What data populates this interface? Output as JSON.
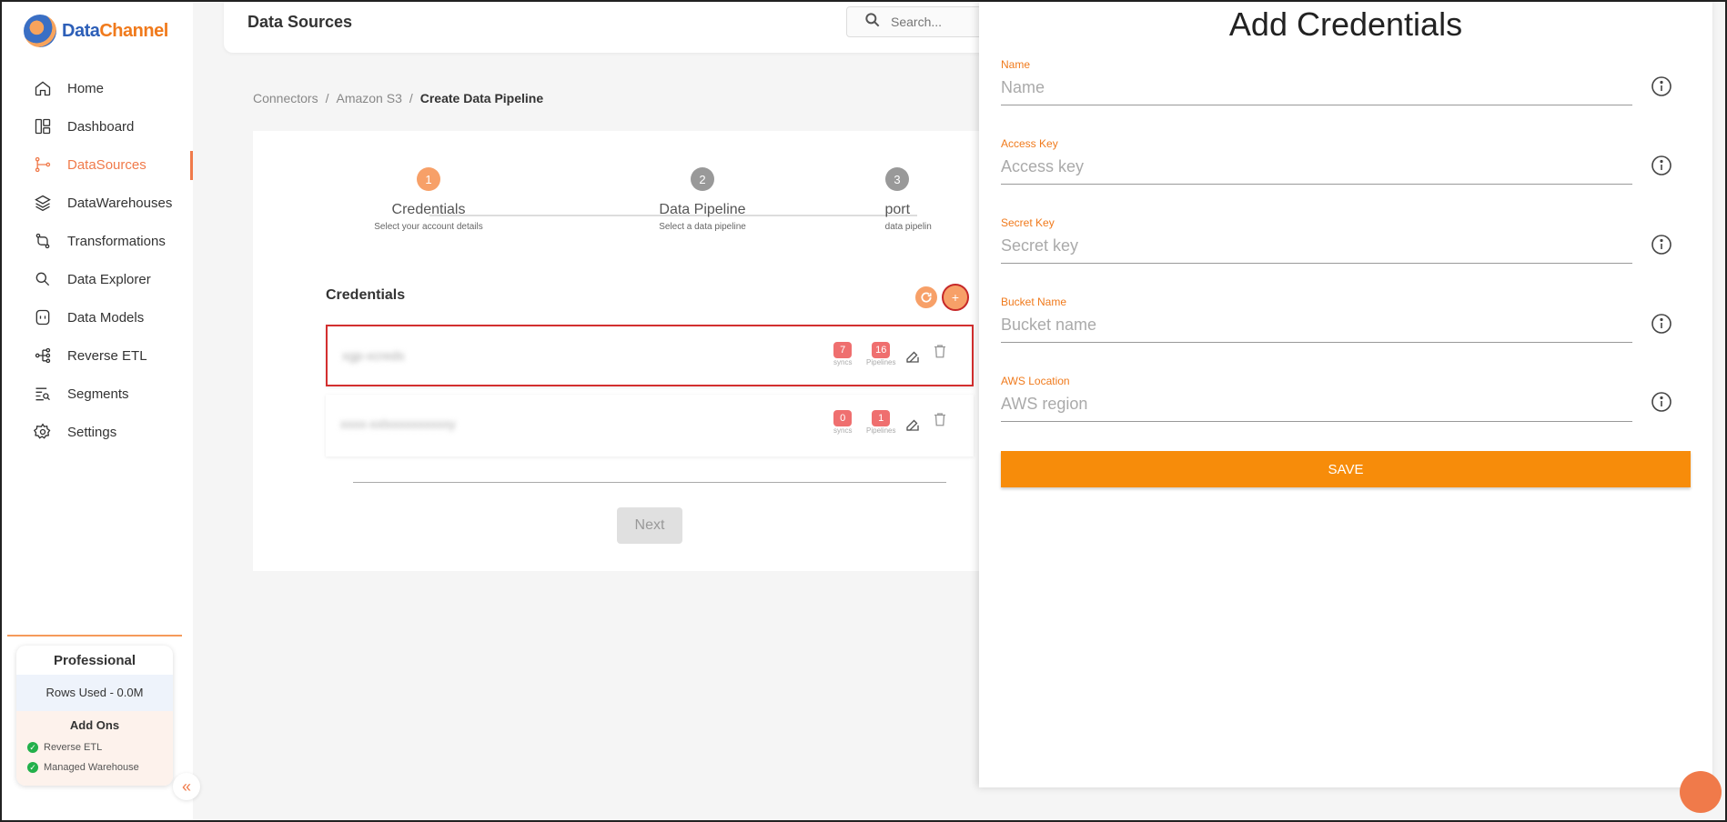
{
  "brand": {
    "name_part1": "Data",
    "name_part2": "Channel"
  },
  "sidebar": {
    "items": [
      {
        "label": "Home",
        "icon": "home-icon"
      },
      {
        "label": "Dashboard",
        "icon": "dashboard-icon"
      },
      {
        "label": "DataSources",
        "icon": "datasources-icon",
        "active": true
      },
      {
        "label": "DataWarehouses",
        "icon": "layers-icon"
      },
      {
        "label": "Transformations",
        "icon": "transform-icon"
      },
      {
        "label": "Data Explorer",
        "icon": "explorer-icon"
      },
      {
        "label": "Data Models",
        "icon": "models-icon"
      },
      {
        "label": "Reverse ETL",
        "icon": "reverse-etl-icon"
      },
      {
        "label": "Segments",
        "icon": "segments-icon"
      },
      {
        "label": "Settings",
        "icon": "gear-icon"
      }
    ],
    "plan": {
      "title": "Professional",
      "rows_used": "Rows Used - 0.0M",
      "addons_title": "Add Ons",
      "addons": [
        "Reverse ETL",
        "Managed Warehouse"
      ]
    },
    "collapse_symbol": "«"
  },
  "header": {
    "title": "Data Sources",
    "search_placeholder": "Search..."
  },
  "breadcrumb": {
    "items": [
      "Connectors",
      "Amazon S3",
      "Create Data Pipeline"
    ],
    "separator": "/"
  },
  "stepper": [
    {
      "num": "1",
      "label": "Credentials",
      "sub": "Select your account details"
    },
    {
      "num": "2",
      "label": "Data Pipeline",
      "sub": "Select a data pipeline"
    },
    {
      "num": "3",
      "label": "Report",
      "sub": "Enter data pipelin"
    }
  ],
  "credentials": {
    "title": "Credentials",
    "add_symbol": "+",
    "rows": [
      {
        "name": "xgp-xcreds",
        "syncs": "7",
        "pipelines": "16",
        "syncs_label": "syncs",
        "pipelines_label": "Pipelines"
      },
      {
        "name": "xxxx-xxlxxxxxxxxxxy",
        "syncs": "0",
        "pipelines": "1",
        "syncs_label": "syncs",
        "pipelines_label": "Pipelines"
      }
    ]
  },
  "next_label": "Next",
  "drawer": {
    "title": "Add Credentials",
    "fields": [
      {
        "label": "Name",
        "placeholder": "Name"
      },
      {
        "label": "Access Key",
        "placeholder": "Access key"
      },
      {
        "label": "Secret Key",
        "placeholder": "Secret key"
      },
      {
        "label": "Bucket Name",
        "placeholder": "Bucket name"
      },
      {
        "label": "AWS Location",
        "placeholder": "AWS region"
      }
    ],
    "save_label": "SAVE"
  },
  "colors": {
    "accent": "#f07a4a",
    "save": "#f78c0a",
    "badge": "#ef6f6f",
    "selected_border": "#d32f2f"
  }
}
